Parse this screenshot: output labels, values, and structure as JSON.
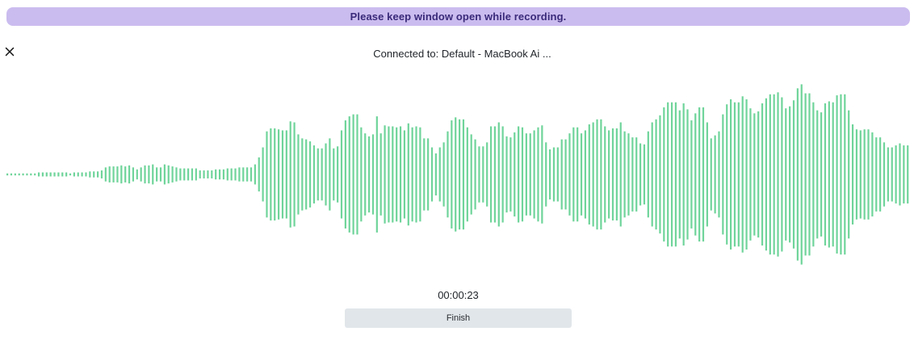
{
  "banner": {
    "text": "Please keep window open while recording."
  },
  "header": {
    "close_icon": "close-icon",
    "device_label": "Connected to: Default - MacBook Ai ..."
  },
  "waveform": {
    "color": "#6fd49a",
    "levels": [
      0.01,
      0.01,
      0.01,
      0.01,
      0.01,
      0.01,
      0.01,
      0.02,
      0.02,
      0.02,
      0.02,
      0.02,
      0.02,
      0.02,
      0.01,
      0.02,
      0.02,
      0.02,
      0.03,
      0.03,
      0.03,
      0.04,
      0.07,
      0.08,
      0.08,
      0.09,
      0.08,
      0.09,
      0.07,
      0.05,
      0.07,
      0.09,
      0.1,
      0.07,
      0.07,
      0.1,
      0.09,
      0.08,
      0.07,
      0.06,
      0.06,
      0.06,
      0.06,
      0.04,
      0.04,
      0.04,
      0.04,
      0.05,
      0.05,
      0.06,
      0.06,
      0.06,
      0.07,
      0.07,
      0.07,
      0.1,
      0.17,
      0.27,
      0.43,
      0.46,
      0.46,
      0.45,
      0.44,
      0.53,
      0.52,
      0.4,
      0.36,
      0.35,
      0.33,
      0.29,
      0.26,
      0.31,
      0.36,
      0.26,
      0.28,
      0.44,
      0.54,
      0.58,
      0.6,
      0.47,
      0.41,
      0.38,
      0.4,
      0.58,
      0.41,
      0.49,
      0.48,
      0.47,
      0.48,
      0.44,
      0.51,
      0.47,
      0.48,
      0.47,
      0.36,
      0.27,
      0.21,
      0.27,
      0.32,
      0.43,
      0.54,
      0.57,
      0.55,
      0.47,
      0.4,
      0.35,
      0.28,
      0.28,
      0.32,
      0.48,
      0.52,
      0.48,
      0.38,
      0.37,
      0.42,
      0.48,
      0.47,
      0.41,
      0.44,
      0.47,
      0.49,
      0.32,
      0.25,
      0.27,
      0.27,
      0.35,
      0.41,
      0.47,
      0.47,
      0.41,
      0.44,
      0.5,
      0.52,
      0.55,
      0.48,
      0.44,
      0.46,
      0.46,
      0.52,
      0.43,
      0.41,
      0.37,
      0.31,
      0.3,
      0.43,
      0.52,
      0.55,
      0.59,
      0.67,
      0.72,
      0.72,
      0.64,
      0.71,
      0.65,
      0.54,
      0.61,
      0.67,
      0.52,
      0.36,
      0.39,
      0.43,
      0.6,
      0.7,
      0.75,
      0.72,
      0.78,
      0.75,
      0.66,
      0.61,
      0.63,
      0.71,
      0.76,
      0.8,
      0.82,
      0.77,
      0.66,
      0.68,
      0.74,
      0.86,
      0.9,
      0.81,
      0.72,
      0.64,
      0.62,
      0.71,
      0.73,
      0.72,
      0.79,
      0.8,
      0.64,
      0.5,
      0.45,
      0.44,
      0.45,
      0.45,
      0.42,
      0.37,
      0.32,
      0.27,
      0.27,
      0.29,
      0.31,
      0.29,
      0.29
    ],
    "slots": 230
  },
  "timer": {
    "text": "00:00:23"
  },
  "actions": {
    "finish_label": "Finish"
  }
}
